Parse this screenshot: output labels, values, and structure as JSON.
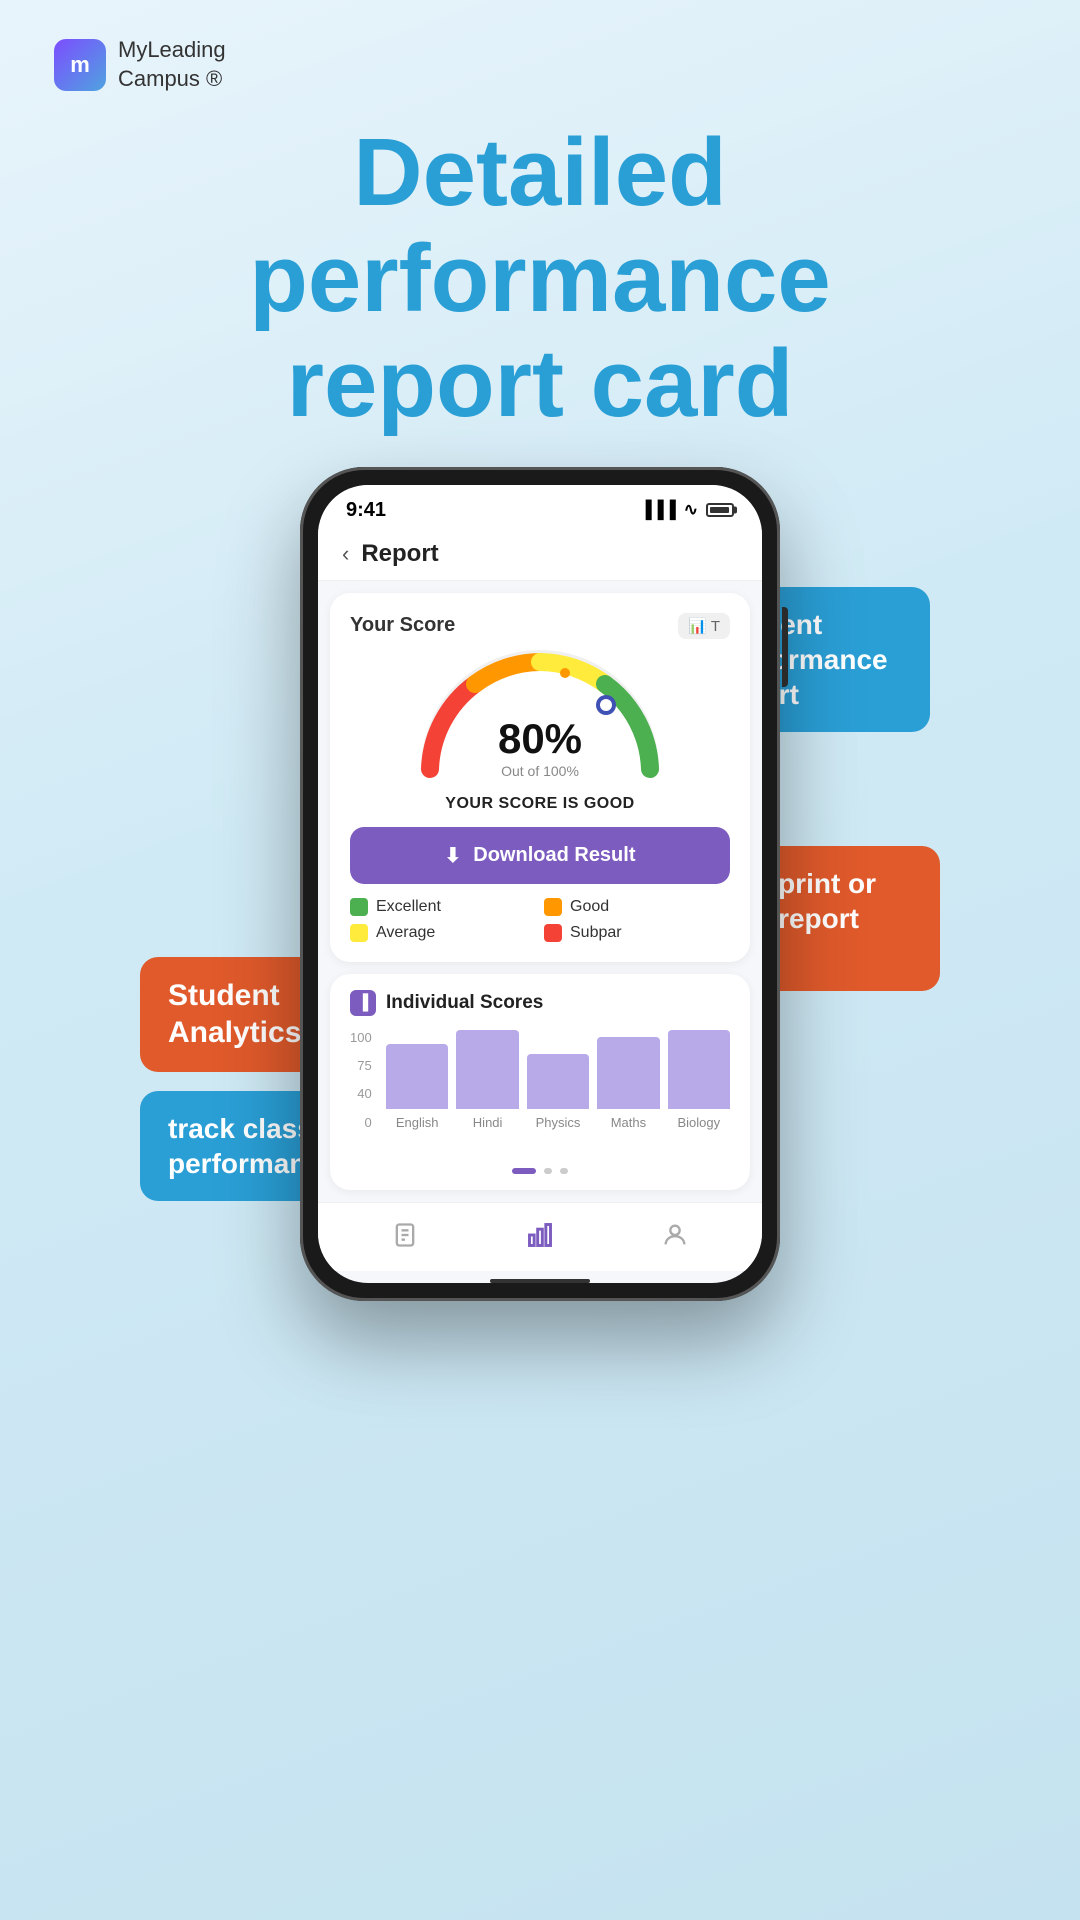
{
  "brand": {
    "logo_letter": "m",
    "name_line1": "MyLeading",
    "name_line2": "Campus ®"
  },
  "hero": {
    "line1": "Detailed",
    "line2": "performance",
    "line3": "report card"
  },
  "phone": {
    "status_time": "9:41",
    "screen": {
      "navbar_back": "‹",
      "navbar_title": "Report",
      "score_section_label": "Your Score",
      "gauge_percent": "80%",
      "gauge_out_of": "Out of 100%",
      "gauge_message": "YOUR SCORE IS GOOD",
      "download_btn_label": "Download Result",
      "legend": [
        {
          "label": "Excellent",
          "color": "#4caf50"
        },
        {
          "label": "Good",
          "color": "#ff9800"
        },
        {
          "label": "Average",
          "color": "#ffeb3b"
        },
        {
          "label": "Subpar",
          "color": "#f44336"
        }
      ],
      "individual_scores_title": "Individual Scores",
      "chart_y_labels": [
        "100",
        "75",
        "40",
        "0"
      ],
      "bars": [
        {
          "subject": "English",
          "height_pct": 65
        },
        {
          "subject": "Hindi",
          "height_pct": 82
        },
        {
          "subject": "Physics",
          "height_pct": 55
        },
        {
          "subject": "Maths",
          "height_pct": 72
        },
        {
          "subject": "Biology",
          "height_pct": 88
        }
      ]
    }
  },
  "bubbles": {
    "student_performance": "Student performance report",
    "student_analytics": "Student Analytics",
    "easy_print": "easy print or save report card",
    "track_class": "track class performane"
  }
}
